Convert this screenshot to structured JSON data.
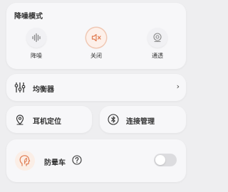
{
  "noise_control": {
    "title": "降噪模式",
    "modes": [
      {
        "label": "降噪",
        "icon": "noise-cancel-icon",
        "active": false
      },
      {
        "label": "关闭",
        "icon": "mute-speaker-icon",
        "active": true
      },
      {
        "label": "通透",
        "icon": "transparency-icon",
        "active": false
      }
    ]
  },
  "equalizer": {
    "label": "均衡器",
    "icon": "equalizer-icon",
    "chevron": "›"
  },
  "locate": {
    "label": "耳机定位",
    "icon": "location-pin-icon"
  },
  "connection": {
    "label": "连接管理",
    "icon": "bluetooth-icon"
  },
  "motion_sickness": {
    "label": "防晕车",
    "icon": "head-leaf-icon",
    "help_icon": "help-icon",
    "enabled": false
  },
  "colors": {
    "accent": "#e07a4f",
    "background": "#eeeef0",
    "card": "#f7f7f9"
  }
}
